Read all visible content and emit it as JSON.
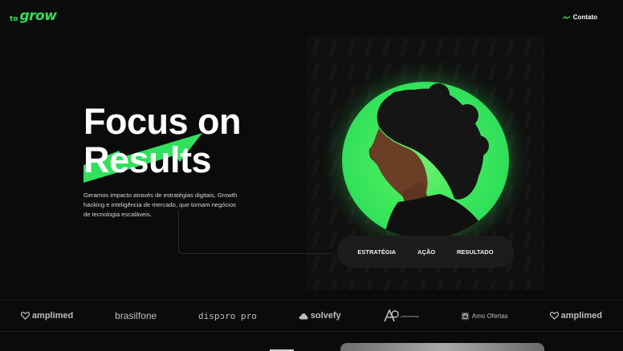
{
  "header": {
    "logo_prefix": "to",
    "logo_main": "grow",
    "contact_label": "Contato"
  },
  "hero": {
    "title_line1": "Focus on",
    "title_line2": "Results",
    "description": "Geramos impacto através de estratégias digitais, Growth hacking e inteligência de mercado,  que tornam negócios de tecnologia escaláveis."
  },
  "steps": [
    "ESTRATÉGIA",
    "AÇÃO",
    "RESULTADO"
  ],
  "clients": [
    {
      "name": "amplimed",
      "icon": "heart-icon"
    },
    {
      "name": "brasilfone",
      "icon": ""
    },
    {
      "name": "dispɔro pro",
      "icon": ""
    },
    {
      "name": "solvefy",
      "icon": "cloud-icon"
    },
    {
      "name": "performance",
      "icon": "a-logo-icon"
    },
    {
      "name": "Amo Ofertas",
      "icon": "bag-icon"
    },
    {
      "name": "amplimed",
      "icon": "heart-icon"
    }
  ],
  "colors": {
    "accent": "#31e05c",
    "background": "#0b0b0b"
  }
}
